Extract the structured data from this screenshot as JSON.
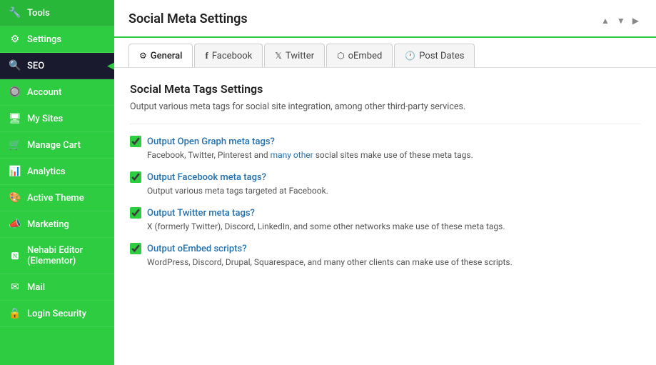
{
  "sidebar": {
    "items": [
      {
        "id": "tools",
        "label": "Tools",
        "icon": "🔧"
      },
      {
        "id": "settings",
        "label": "Settings",
        "icon": "⚙"
      },
      {
        "id": "seo",
        "label": "SEO",
        "icon": "🔍",
        "active": true
      },
      {
        "id": "account",
        "label": "Account",
        "icon": "🔘"
      },
      {
        "id": "my-sites",
        "label": "My Sites",
        "icon": "🖥"
      },
      {
        "id": "manage-cart",
        "label": "Manage Cart",
        "icon": "🛒"
      },
      {
        "id": "analytics",
        "label": "Analytics",
        "icon": "📊"
      },
      {
        "id": "active-theme",
        "label": "Active Theme",
        "icon": "🎨"
      },
      {
        "id": "marketing",
        "label": "Marketing",
        "icon": "📣"
      },
      {
        "id": "nehabi-editor",
        "label": "Nehabi Editor (Elementor)",
        "icon": "🅽"
      },
      {
        "id": "mail",
        "label": "Mail",
        "icon": "✉"
      },
      {
        "id": "login-security",
        "label": "Login Security",
        "icon": "🔒"
      }
    ]
  },
  "main": {
    "title": "Social Meta Settings",
    "tabs": [
      {
        "id": "general",
        "label": "General",
        "icon": "⚙",
        "active": true
      },
      {
        "id": "facebook",
        "label": "Facebook",
        "icon": "f"
      },
      {
        "id": "twitter",
        "label": "Twitter",
        "icon": "𝕏"
      },
      {
        "id": "oembed",
        "label": "oEmbed",
        "icon": "⬡"
      },
      {
        "id": "post-dates",
        "label": "Post Dates",
        "icon": "🕐"
      }
    ],
    "content": {
      "section_title": "Social Meta Tags Settings",
      "section_desc": "Output various meta tags for social site integration, among other third-party services.",
      "settings": [
        {
          "id": "open-graph",
          "label": "Output Open Graph meta tags?",
          "checked": true,
          "description": "Facebook, Twitter, Pinterest and many other social sites make use of these meta tags."
        },
        {
          "id": "facebook-meta",
          "label": "Output Facebook meta tags?",
          "checked": true,
          "description": "Output various meta tags targeted at Facebook."
        },
        {
          "id": "twitter-meta",
          "label": "Output Twitter meta tags?",
          "checked": true,
          "description": "X (formerly Twitter), Discord, LinkedIn, and some other networks make use of these meta tags."
        },
        {
          "id": "oembed-scripts",
          "label": "Output oEmbed scripts?",
          "checked": true,
          "description": "WordPress, Discord, Drupal, Squarespace, and many other clients can make use of these scripts."
        }
      ]
    }
  }
}
